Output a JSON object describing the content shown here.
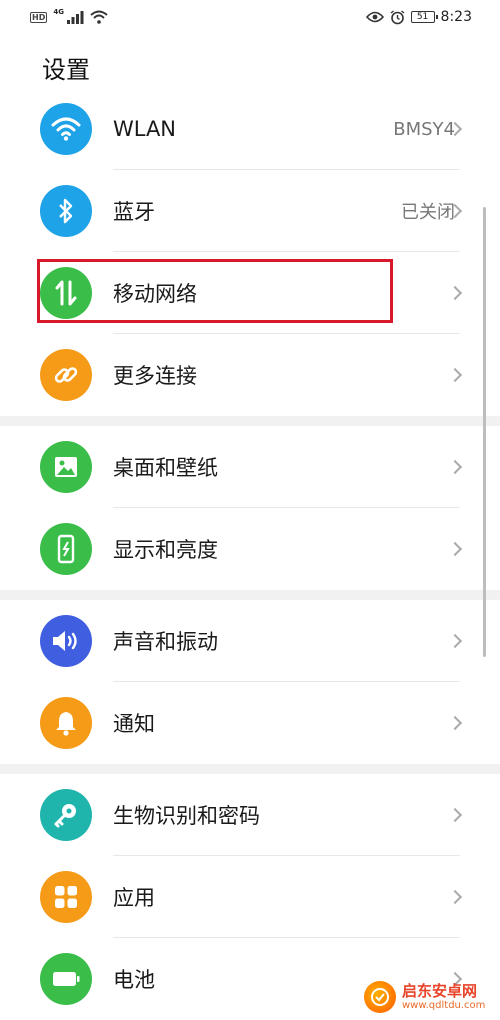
{
  "status_bar": {
    "hd": "HD",
    "network": "4G",
    "battery_level": "51",
    "time": "8:23"
  },
  "page_title": "设置",
  "groups": [
    [
      {
        "name": "wlan",
        "label": "WLAN",
        "value": "BMSY4",
        "icon": "wifi-icon",
        "color": "#1ea3e8"
      },
      {
        "name": "bluetooth",
        "label": "蓝牙",
        "value": "已关闭",
        "icon": "bluetooth-icon",
        "color": "#1ea3e8"
      },
      {
        "name": "mobile-network",
        "label": "移动网络",
        "value": "",
        "icon": "mobile-data-icon",
        "color": "#3bbd4a"
      },
      {
        "name": "more-connections",
        "label": "更多连接",
        "value": "",
        "icon": "link-icon",
        "color": "#f59b17"
      }
    ],
    [
      {
        "name": "home-wallpaper",
        "label": "桌面和壁纸",
        "value": "",
        "icon": "image-icon",
        "color": "#3bbd4a"
      },
      {
        "name": "display-brightness",
        "label": "显示和亮度",
        "value": "",
        "icon": "phone-brightness-icon",
        "color": "#3bbd4a"
      }
    ],
    [
      {
        "name": "sound-vibration",
        "label": "声音和振动",
        "value": "",
        "icon": "speaker-icon",
        "color": "#3f5fe0"
      },
      {
        "name": "notifications",
        "label": "通知",
        "value": "",
        "icon": "bell-icon",
        "color": "#f59b17"
      }
    ],
    [
      {
        "name": "biometrics-password",
        "label": "生物识别和密码",
        "value": "",
        "icon": "key-icon",
        "color": "#1fb5ad"
      },
      {
        "name": "apps",
        "label": "应用",
        "value": "",
        "icon": "grid-icon",
        "color": "#f59b17"
      },
      {
        "name": "battery",
        "label": "电池",
        "value": "",
        "icon": "battery-icon",
        "color": "#3bbd4a"
      }
    ]
  ],
  "watermark": {
    "title": "启东安卓网",
    "url": "www.qdltdu.com"
  }
}
